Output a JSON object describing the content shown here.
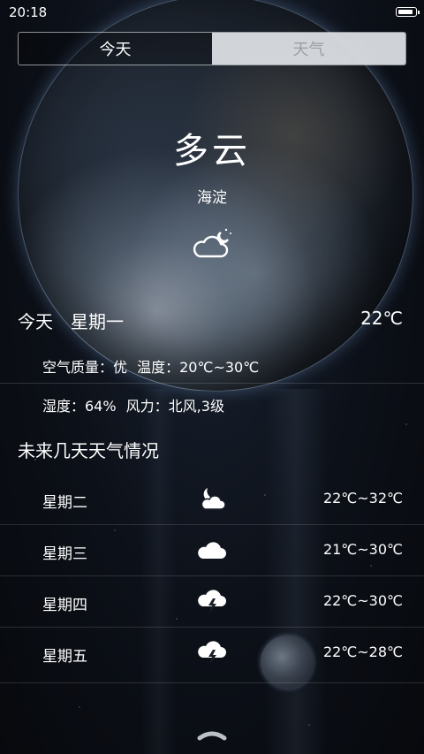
{
  "status": {
    "time": "20:18",
    "battery_level": 0.9
  },
  "tabs": [
    {
      "label": "今天",
      "active": true
    },
    {
      "label": "天气",
      "active": false
    }
  ],
  "current": {
    "condition": "多云",
    "district": "海淀",
    "icon": "cloud-moon-icon"
  },
  "today": {
    "day_label": "今天",
    "weekday": "星期一",
    "temperature": "22℃",
    "air_quality_label": "空气质量：优",
    "temp_range_label": "温度：20℃~30℃",
    "humidity_label": "湿度：64%",
    "wind_label": "风力：北风,3级"
  },
  "forecast": {
    "title": "未来几天天气情况",
    "days": [
      {
        "day": "星期二",
        "icon": "moon-cloud-icon",
        "range": "22℃~32℃"
      },
      {
        "day": "星期三",
        "icon": "cloud-icon",
        "range": "21℃~30℃"
      },
      {
        "day": "星期四",
        "icon": "thunderstorm-icon",
        "range": "22℃~30℃"
      },
      {
        "day": "星期五",
        "icon": "thunderstorm-icon",
        "range": "22℃~28℃"
      }
    ]
  },
  "colors": {
    "text": "#ffffff",
    "tab_inactive_bg": "#e1e4e8",
    "tab_inactive_text": "#9aa0a8"
  }
}
